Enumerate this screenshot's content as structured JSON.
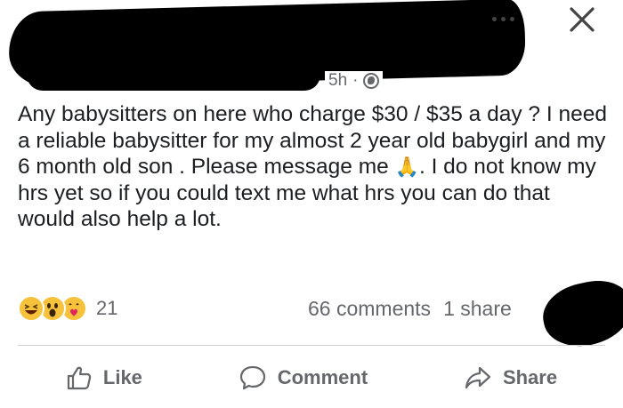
{
  "post": {
    "timestamp": "5h",
    "separator": "·",
    "privacy_icon": "globe-icon",
    "text_part1": "Any babysitters on here who charge $30 / $35 a day ? I need a reliable babysitter for my almost 2 year old babygirl and my 6 month old son . Please message me ",
    "emoji": "🙏",
    "text_part2": ". I do not know my hrs yet so if you could text me what hrs you can do that would also help a lot."
  },
  "header": {
    "more_icon": "more-options-icon",
    "close_icon": "close-icon"
  },
  "stats": {
    "reactions": [
      "haha",
      "wow",
      "care"
    ],
    "reaction_count": "21",
    "comments": "66 comments",
    "shares": "1 share"
  },
  "actions": {
    "like": "Like",
    "comment": "Comment",
    "share": "Share"
  },
  "colors": {
    "text": "#1c1e21",
    "secondary": "#65676b",
    "divider": "#ced0d4",
    "reaction_yellow": "#f7c23b"
  }
}
